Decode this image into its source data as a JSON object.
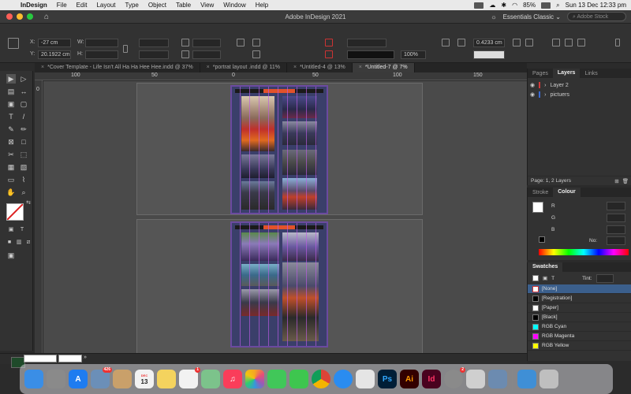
{
  "menubar": {
    "app_name": "InDesign",
    "items": [
      "File",
      "Edit",
      "Layout",
      "Type",
      "Object",
      "Table",
      "View",
      "Window",
      "Help"
    ],
    "battery": "85%",
    "datetime": "Sun 13 Dec  12:33 pm"
  },
  "titlebar": {
    "title": "Adobe InDesign 2021",
    "workspace": "Essentials Classic",
    "stock_placeholder": "Adobe Stock"
  },
  "control": {
    "x_label": "X:",
    "x_value": "-27 cm",
    "y_label": "Y:",
    "y_value": "20.1922 cm",
    "w_label": "W:",
    "h_label": "H:",
    "stroke_weight": "0.4233 cm",
    "scale_pct": "100%"
  },
  "tabs": [
    {
      "label": "*Cover Template - Life Isn't All Ha Ha Hee Hee.indd @ 37%"
    },
    {
      "label": "*portrat layout .indd @ 11%"
    },
    {
      "label": "*Untitled-4 @ 13%"
    },
    {
      "label": "*Untitled-7 @ 7%"
    }
  ],
  "ruler_labels": [
    "100",
    "50",
    "0",
    "50",
    "100",
    "150"
  ],
  "ruler_v_labels": [
    "0"
  ],
  "layers_panel": {
    "tabs": [
      "Pages",
      "Layers",
      "Links"
    ],
    "layers": [
      {
        "name": "Layer 2",
        "color": "#d33a3a"
      },
      {
        "name": "pictuers",
        "color": "#3a6ad3"
      }
    ],
    "footer": "Page: 1, 2 Layers"
  },
  "colour_panel": {
    "tabs": [
      "Stroke",
      "Colour"
    ],
    "channels": [
      "R",
      "G",
      "B"
    ],
    "no_label": "No:"
  },
  "swatches_panel": {
    "title": "Swatches",
    "tint_label": "Tint:",
    "items": [
      {
        "name": "[None]",
        "color": "none"
      },
      {
        "name": "[Registration]",
        "color": "#000000"
      },
      {
        "name": "[Paper]",
        "color": "#ffffff"
      },
      {
        "name": "[Black]",
        "color": "#000000"
      },
      {
        "name": "RGB Cyan",
        "color": "#00ffff"
      },
      {
        "name": "RGB Magenta",
        "color": "#ff00ff"
      },
      {
        "name": "RGB Yellow",
        "color": "#ffff00"
      }
    ]
  },
  "dock": {
    "calendar_month": "DEC",
    "calendar_day": "13",
    "apps": [
      {
        "name": "Finder",
        "label": "",
        "color": "#3a8ee6"
      },
      {
        "name": "Launchpad",
        "label": "",
        "color": "#8a8a8a"
      },
      {
        "name": "App Store",
        "label": "A",
        "color": "#1e7cf0"
      },
      {
        "name": "Preview",
        "label": "",
        "color": "#6b8fb8",
        "badge": "426"
      },
      {
        "name": "Contacts",
        "label": "",
        "color": "#c9a06a"
      },
      {
        "name": "Calendar",
        "label": "",
        "color": "#f2f2f2"
      },
      {
        "name": "Notes",
        "label": "",
        "color": "#f4d35e"
      },
      {
        "name": "Reminders",
        "label": "",
        "color": "#f2f2f2",
        "badge": "1"
      },
      {
        "name": "Maps",
        "label": "",
        "color": "#7cc38b"
      },
      {
        "name": "Music",
        "label": "♫",
        "color": "#fa3d5a"
      },
      {
        "name": "Photos",
        "label": "",
        "color": "#f2f2f2"
      },
      {
        "name": "Messages",
        "label": "",
        "color": "#41c759"
      },
      {
        "name": "FaceTime",
        "label": "",
        "color": "#3ec64f"
      },
      {
        "name": "Chrome",
        "label": "",
        "color": "#e8eaed"
      },
      {
        "name": "Safari",
        "label": "",
        "color": "#2a8cf0"
      },
      {
        "name": "Brave",
        "label": "",
        "color": "#e5e5e5"
      },
      {
        "name": "Photoshop",
        "label": "Ps",
        "color": "#001e36"
      },
      {
        "name": "Illustrator",
        "label": "Ai",
        "color": "#330000"
      },
      {
        "name": "InDesign",
        "label": "Id",
        "color": "#49021f"
      },
      {
        "name": "System Preferences",
        "label": "",
        "color": "#8a8a8a",
        "badge": "2"
      },
      {
        "name": "Preview 2",
        "label": "",
        "color": "#cfcfcf"
      },
      {
        "name": "Photo Viewer",
        "label": "",
        "color": "#6c8bb0"
      },
      {
        "name": "Folder",
        "label": "",
        "color": "#3f8fd6"
      },
      {
        "name": "Trash",
        "label": "",
        "color": "#bfbfbf"
      }
    ]
  }
}
